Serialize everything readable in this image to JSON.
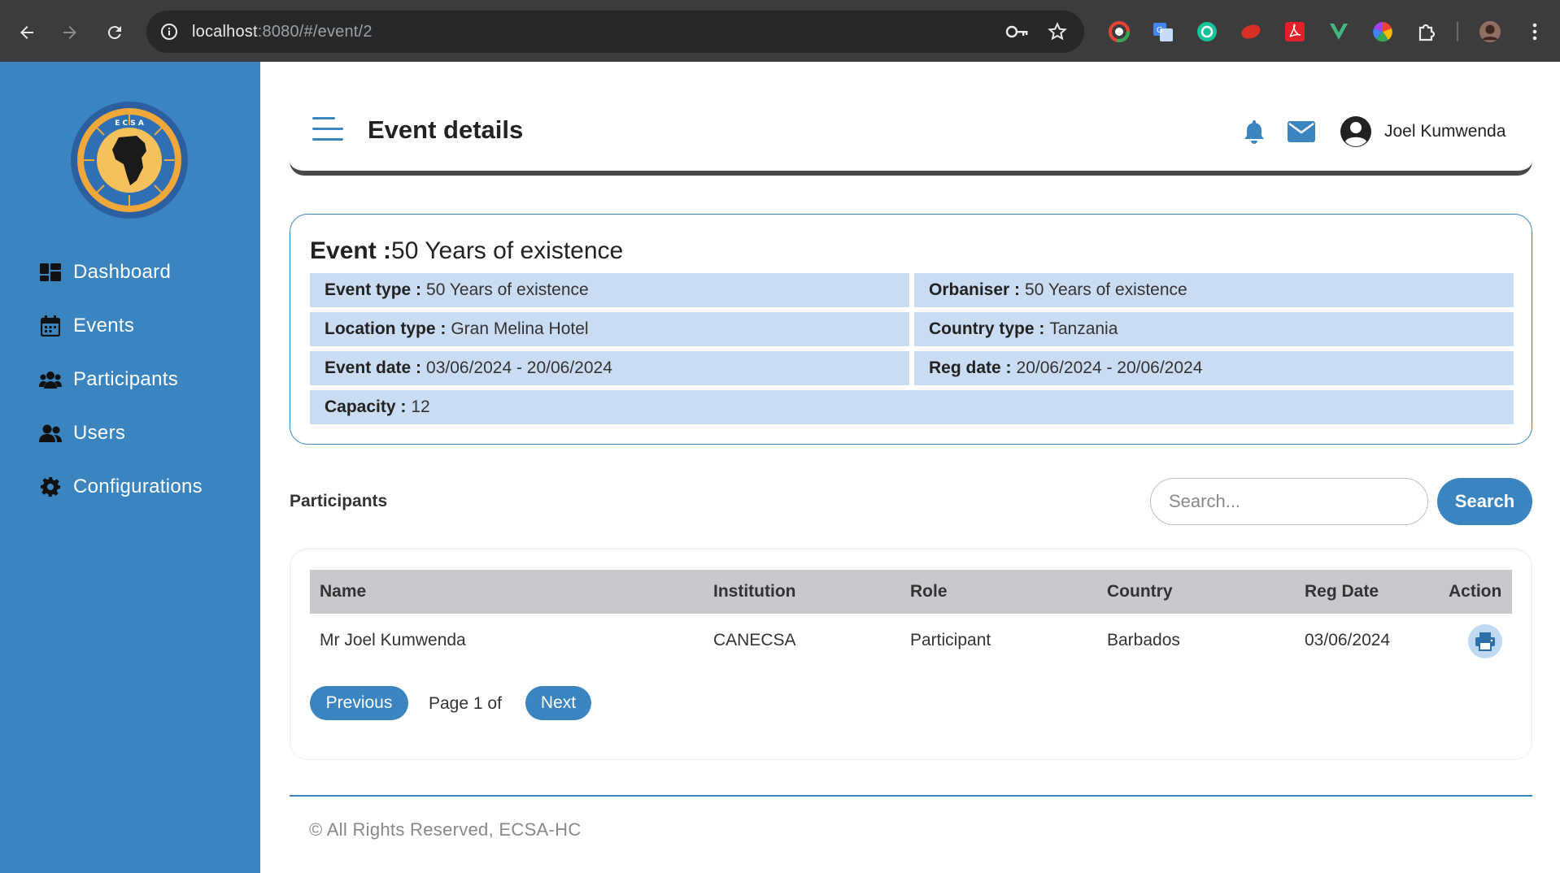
{
  "browser": {
    "url_host": "localhost",
    "url_rest": ":8080/#/event/2"
  },
  "sidebar": {
    "items": [
      {
        "label": "Dashboard",
        "icon": "dashboard-icon"
      },
      {
        "label": "Events",
        "icon": "calendar-icon"
      },
      {
        "label": "Participants",
        "icon": "participants-icon"
      },
      {
        "label": "Users",
        "icon": "users-icon"
      },
      {
        "label": "Configurations",
        "icon": "gear-icon"
      }
    ]
  },
  "header": {
    "title": "Event details",
    "user_name": "Joel Kumwenda"
  },
  "event": {
    "heading_label": "Event :",
    "heading_value": "50 Years of existence",
    "fields": [
      {
        "label": "Event type :",
        "value": "50 Years of existence"
      },
      {
        "label": "Orbaniser :",
        "value": "50 Years of existence"
      },
      {
        "label": "Location type :",
        "value": "Gran Melina Hotel"
      },
      {
        "label": "Country type :",
        "value": "Tanzania"
      },
      {
        "label": "Event date :",
        "value": "03/06/2024 - 20/06/2024"
      },
      {
        "label": "Reg date :",
        "value": "20/06/2024 - 20/06/2024"
      },
      {
        "label": "Capacity :",
        "value": "12"
      }
    ]
  },
  "participants": {
    "title": "Participants",
    "search_placeholder": "Search...",
    "search_button": "Search",
    "columns": [
      "Name",
      "Institution",
      "Role",
      "Country",
      "Reg Date",
      "Action"
    ],
    "rows": [
      {
        "name": "Mr Joel Kumwenda",
        "institution": "CANECSA",
        "role": "Participant",
        "country": "Barbados",
        "reg_date": "03/06/2024"
      }
    ],
    "pagination": {
      "previous": "Previous",
      "page_info": "Page 1 of",
      "next": "Next"
    }
  },
  "footer": {
    "text": "© All Rights Reserved, ECSA-HC"
  },
  "colors": {
    "primary": "#3a84c0",
    "info_bg": "#c9dcf2",
    "table_head": "#c8c9cc"
  }
}
